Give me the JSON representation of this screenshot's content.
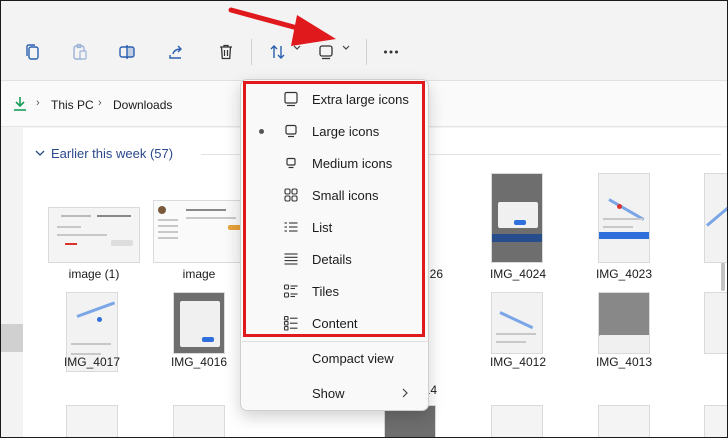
{
  "breadcrumb": {
    "segments": [
      "This PC",
      "Downloads"
    ]
  },
  "group": {
    "header": "Earlier this week (57)"
  },
  "files": [
    {
      "name": "image (1)"
    },
    {
      "name": "image"
    },
    {
      "name": "26"
    },
    {
      "name": "IMG_4024"
    },
    {
      "name": "IMG_4023"
    },
    {
      "name": "IMG_4017"
    },
    {
      "name": "IMG_4016"
    },
    {
      "name": "14"
    },
    {
      "name": "IMG_4012"
    },
    {
      "name": "IMG_4013"
    }
  ],
  "view_menu": {
    "items": [
      {
        "label": "Extra large icons",
        "icon": "extra-large-icons-icon",
        "selected": false
      },
      {
        "label": "Large icons",
        "icon": "large-icons-icon",
        "selected": true
      },
      {
        "label": "Medium icons",
        "icon": "medium-icons-icon",
        "selected": false
      },
      {
        "label": "Small icons",
        "icon": "small-icons-icon",
        "selected": false
      },
      {
        "label": "List",
        "icon": "list-icon",
        "selected": false
      },
      {
        "label": "Details",
        "icon": "details-icon",
        "selected": false
      },
      {
        "label": "Tiles",
        "icon": "tiles-icon",
        "selected": false
      },
      {
        "label": "Content",
        "icon": "content-icon",
        "selected": false
      }
    ],
    "compact_view": "Compact view",
    "show": "Show"
  },
  "colors": {
    "highlight_box": "#e0191d",
    "accent": "#2f6fdb",
    "download_icon": "#1a9e5a"
  }
}
